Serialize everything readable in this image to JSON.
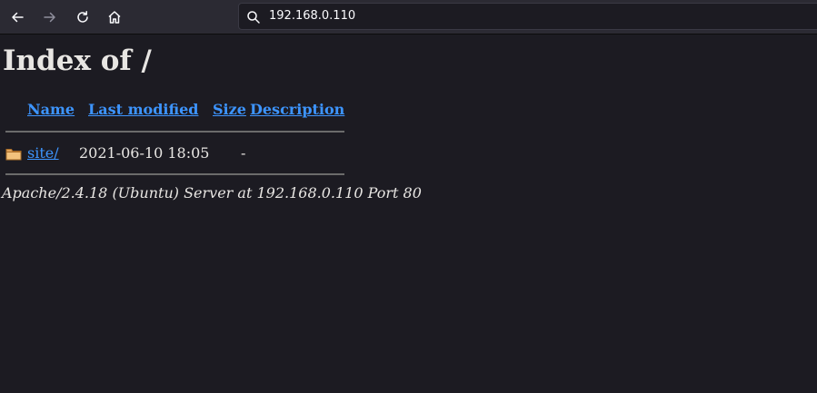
{
  "browser": {
    "url": "192.168.0.110",
    "icons": {
      "back": "back-arrow-icon",
      "forward": "forward-arrow-icon",
      "reload": "reload-icon",
      "home": "home-icon",
      "search": "search-icon"
    }
  },
  "page": {
    "title": "Index of /",
    "columns": {
      "name": "Name",
      "last_modified": "Last modified",
      "size": "Size",
      "description": "Description"
    },
    "rows": [
      {
        "icon": "folder-icon",
        "name": "site/",
        "last_modified": "2021-06-10 18:05",
        "size": "-",
        "description": ""
      }
    ],
    "footer": "Apache/2.4.18 (Ubuntu) Server at 192.168.0.110 Port 80"
  },
  "colors": {
    "background": "#1c1b22",
    "toolbar": "#2b2a33",
    "link": "#3d95ff",
    "text": "#e8e6e3"
  }
}
